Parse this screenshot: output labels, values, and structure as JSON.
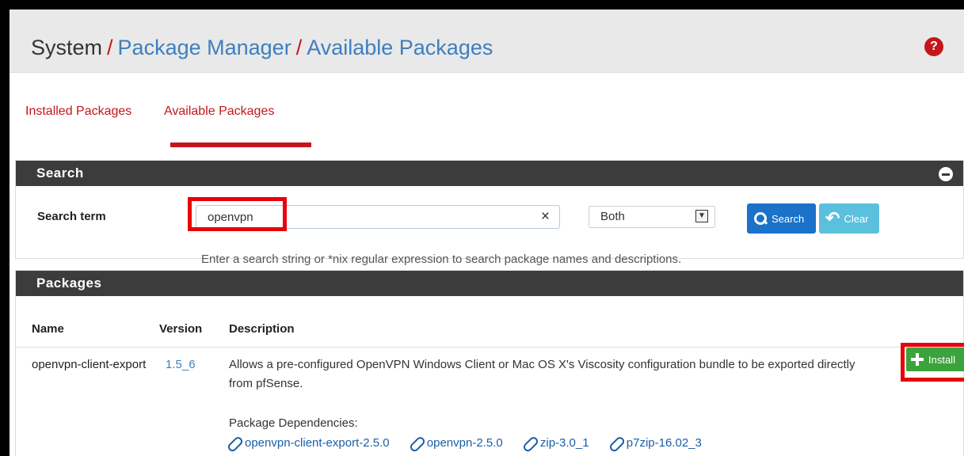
{
  "breadcrumb": {
    "items": [
      "System",
      "Package Manager",
      "Available Packages"
    ],
    "separator": "/"
  },
  "header": {
    "help_icon": "question-circle-icon"
  },
  "tabs": [
    {
      "label": "Installed Packages",
      "active": false
    },
    {
      "label": "Available Packages",
      "active": true
    }
  ],
  "search_panel": {
    "title": "Search",
    "label": "Search term",
    "input_value": "openvpn",
    "clear_glyph": "×",
    "scope_selected": "Both",
    "search_button": "Search",
    "clear_button": "Clear",
    "hint": "Enter a search string or *nix regular expression to search package names and descriptions."
  },
  "packages_panel": {
    "title": "Packages",
    "columns": [
      "Name",
      "Version",
      "Description"
    ],
    "rows": [
      {
        "name": "openvpn-client-export",
        "version": "1.5_6",
        "description": "Allows a pre-configured OpenVPN Windows Client or Mac OS X's Viscosity configuration bundle to be exported directly from pfSense.",
        "dependencies_label": "Package Dependencies:",
        "dependencies": [
          "openvpn-client-export-2.5.0",
          "openvpn-2.5.0",
          "zip-3.0_1",
          "p7zip-16.02_3"
        ],
        "install_label": "Install"
      }
    ]
  },
  "colors": {
    "accent_red": "#c4161c",
    "link_blue": "#3d7fbf",
    "panel_header": "#3c3c3c",
    "install_green": "#3ba33b",
    "highlight": "#e8000b"
  }
}
